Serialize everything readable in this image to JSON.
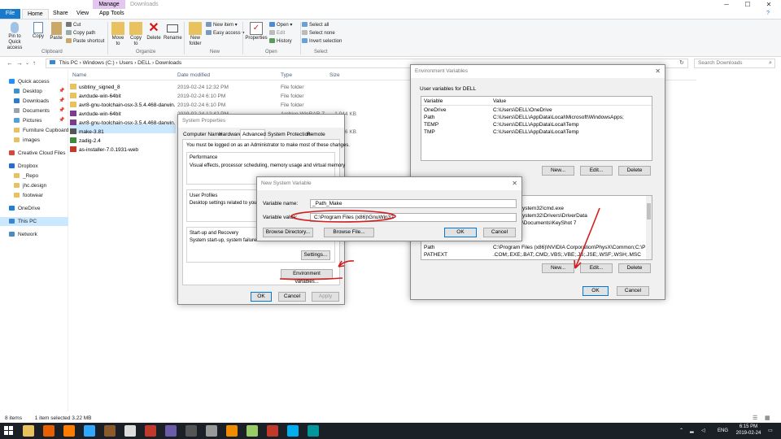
{
  "explorer": {
    "context_tab": "Manage",
    "title": "Downloads",
    "tabs": [
      "File",
      "Home",
      "Share",
      "View",
      "App Tools"
    ],
    "ribbon": {
      "pin": "Pin to Quick access",
      "copy": "Copy",
      "paste": "Paste",
      "cut": "Cut",
      "copy_path": "Copy path",
      "paste_shortcut": "Paste shortcut",
      "clipboard": "Clipboard",
      "move_to": "Move to",
      "copy_to": "Copy to",
      "delete": "Delete",
      "rename": "Rename",
      "organize": "Organize",
      "new_folder": "New folder",
      "new_item": "New item ▾",
      "easy_access": "Easy access ▾",
      "new": "New",
      "properties": "Properties",
      "open": "Open ▾",
      "edit": "Edit",
      "history": "History",
      "open_group": "Open",
      "select_all": "Select all",
      "select_none": "Select none",
      "invert_selection": "Invert selection",
      "select": "Select"
    },
    "address": [
      "This PC",
      "Windows (C:)",
      "Users",
      "DELL",
      "Downloads"
    ],
    "search_placeholder": "Search Downloads",
    "nav": [
      {
        "label": "Quick access",
        "color": "#1e90ff",
        "pin": false
      },
      {
        "label": "Desktop",
        "color": "#3d8fd6",
        "pin": true
      },
      {
        "label": "Downloads",
        "color": "#2e7bd1",
        "pin": true
      },
      {
        "label": "Documents",
        "color": "#9aa4ad",
        "pin": true
      },
      {
        "label": "Pictures",
        "color": "#4ba3d9",
        "pin": true
      },
      {
        "label": "Furniture Cupboard",
        "color": "#e8c25e",
        "pin": false
      },
      {
        "label": "images",
        "color": "#e8c25e",
        "pin": false
      },
      {
        "label": "Creative Cloud Files",
        "color": "#d9463e",
        "pin": false
      },
      {
        "label": "Dropbox",
        "color": "#1f6fd6",
        "pin": false
      },
      {
        "label": "_Repo",
        "color": "#e8c25e",
        "pin": false
      },
      {
        "label": "jhc.design",
        "color": "#e8c25e",
        "pin": false
      },
      {
        "label": "footwear",
        "color": "#e8c25e",
        "pin": false
      },
      {
        "label": "OneDrive",
        "color": "#1c7fd8",
        "pin": false
      },
      {
        "label": "This PC",
        "color": "#3b86d0",
        "pin": false
      },
      {
        "label": "Network",
        "color": "#4a8bc2",
        "pin": false
      }
    ],
    "columns": {
      "name": "Name",
      "date": "Date modified",
      "type": "Type",
      "size": "Size"
    },
    "files": [
      {
        "name": "usbtiny_signed_8",
        "date": "2019-02-24 12:32 PM",
        "type": "File folder",
        "size": "",
        "color": "#e8c25e"
      },
      {
        "name": "avrdude-win-64bit",
        "date": "2019-02-24 6:10 PM",
        "type": "File folder",
        "size": "",
        "color": "#e8c25e"
      },
      {
        "name": "avr8-gnu-toolchain-osx-3.5.4.468-darwin...",
        "date": "2019-02-24 6:10 PM",
        "type": "File folder",
        "size": "",
        "color": "#e8c25e"
      },
      {
        "name": "avrdude-win-64bit",
        "date": "2019-02-24 12:42 PM",
        "type": "Archive WinRAR Z...",
        "size": "1,044 KB",
        "color": "#7a3c8c"
      },
      {
        "name": "avr8-gnu-toolchain-osx-3.5.4.468-darwin...",
        "date": "",
        "type": "",
        "size": "",
        "color": "#7a3c8c"
      },
      {
        "name": "make-3.81",
        "date": "",
        "type": "",
        "size": "86 KB",
        "color": "#555555"
      },
      {
        "name": "zadig-2.4",
        "date": "",
        "type": "",
        "size": "",
        "color": "#3b8b3b"
      },
      {
        "name": "as-installer-7.0.1931-web",
        "date": "",
        "type": "",
        "size": "",
        "color": "#c23a2c"
      }
    ],
    "status": {
      "count": "8 items",
      "selected": "1 item selected  3.22 MB"
    }
  },
  "sysprops": {
    "title": "System Properties",
    "tabs": [
      "Computer Name",
      "Hardware",
      "Advanced",
      "System Protection",
      "Remote"
    ],
    "note": "You must be logged on as an Administrator to make most of these changes.",
    "perf_title": "Performance",
    "perf_desc": "Visual effects, processor scheduling, memory usage and virtual memory",
    "profiles_title": "User Profiles",
    "profiles_desc": "Desktop settings related to your sign",
    "startup_title": "Start-up and Recovery",
    "startup_desc": "System start-up, system failure and",
    "settings": "Settings...",
    "env_vars": "Environment Variables...",
    "ok": "OK",
    "cancel": "Cancel",
    "apply": "Apply"
  },
  "newvar": {
    "title": "New System Variable",
    "name_label": "Variable name:",
    "name_value": "_Path_Make",
    "value_label": "Variable value:",
    "value_value": "C:\\Program Files (x86)\\GnuWin32",
    "browse_dir": "Browse Directory...",
    "browse_file": "Browse File...",
    "ok": "OK",
    "cancel": "Cancel"
  },
  "envvars": {
    "title": "Environment Variables",
    "user_label": "User variables for DELL",
    "col_variable": "Variable",
    "col_value": "Value",
    "user_vars": [
      {
        "name": "OneDrive",
        "value": "C:\\Users\\DELL\\OneDrive"
      },
      {
        "name": "Path",
        "value": "C:\\Users\\DELL\\AppData\\Local\\Microsoft\\WindowsApps;"
      },
      {
        "name": "TEMP",
        "value": "C:\\Users\\DELL\\AppData\\Local\\Temp"
      },
      {
        "name": "TMP",
        "value": "C:\\Users\\DELL\\AppData\\Local\\Temp"
      }
    ],
    "sys_partial": [
      {
        "name": "",
        "value": "ystem32\\cmd.exe"
      },
      {
        "name": "",
        "value": "ystem32\\Drivers\\DriverData"
      },
      {
        "name": "",
        "value": "\\Documents\\KeyShot 7"
      }
    ],
    "sys_vars": [
      {
        "name": "Path",
        "value": "C:\\Program Files (x86)\\NVIDIA Corporation\\PhysX\\Common;C:\\Pro..."
      },
      {
        "name": "PATHEXT",
        "value": ".COM;.EXE;.BAT;.CMD;.VBS;.VBE;.JS;.JSE;.WSF;.WSH;.MSC"
      }
    ],
    "new": "New...",
    "edit": "Edit...",
    "delete": "Delete",
    "ok": "OK",
    "cancel": "Cancel"
  },
  "taskbar": {
    "icons": [
      {
        "name": "windows-start-icon",
        "color": "#1b2026"
      },
      {
        "name": "file-explorer-icon",
        "color": "#e8c25e"
      },
      {
        "name": "firefox-icon",
        "color": "#e66000"
      },
      {
        "name": "illustrator-icon",
        "color": "#ff7c00"
      },
      {
        "name": "photoshop-icon",
        "color": "#31a8ff"
      },
      {
        "name": "bridge-icon",
        "color": "#8b5a2b"
      },
      {
        "name": "chrome-icon",
        "color": "#dddddd"
      },
      {
        "name": "winrar-icon",
        "color": "#c0392b"
      },
      {
        "name": "app-icon",
        "color": "#6b5ba8"
      },
      {
        "name": "dropbox-app-icon",
        "color": "#555555"
      },
      {
        "name": "pen-tool-icon",
        "color": "#999999"
      },
      {
        "name": "vlc-icon",
        "color": "#f08c00"
      },
      {
        "name": "flowers-app-icon",
        "color": "#9c6"
      },
      {
        "name": "adobe-acrobat-icon",
        "color": "#c0392b"
      },
      {
        "name": "skype-icon",
        "color": "#00aff0"
      },
      {
        "name": "arduino-icon",
        "color": "#00979c"
      }
    ],
    "lang": "ENG",
    "time": "6:15 PM",
    "date": "2019-02-24"
  }
}
